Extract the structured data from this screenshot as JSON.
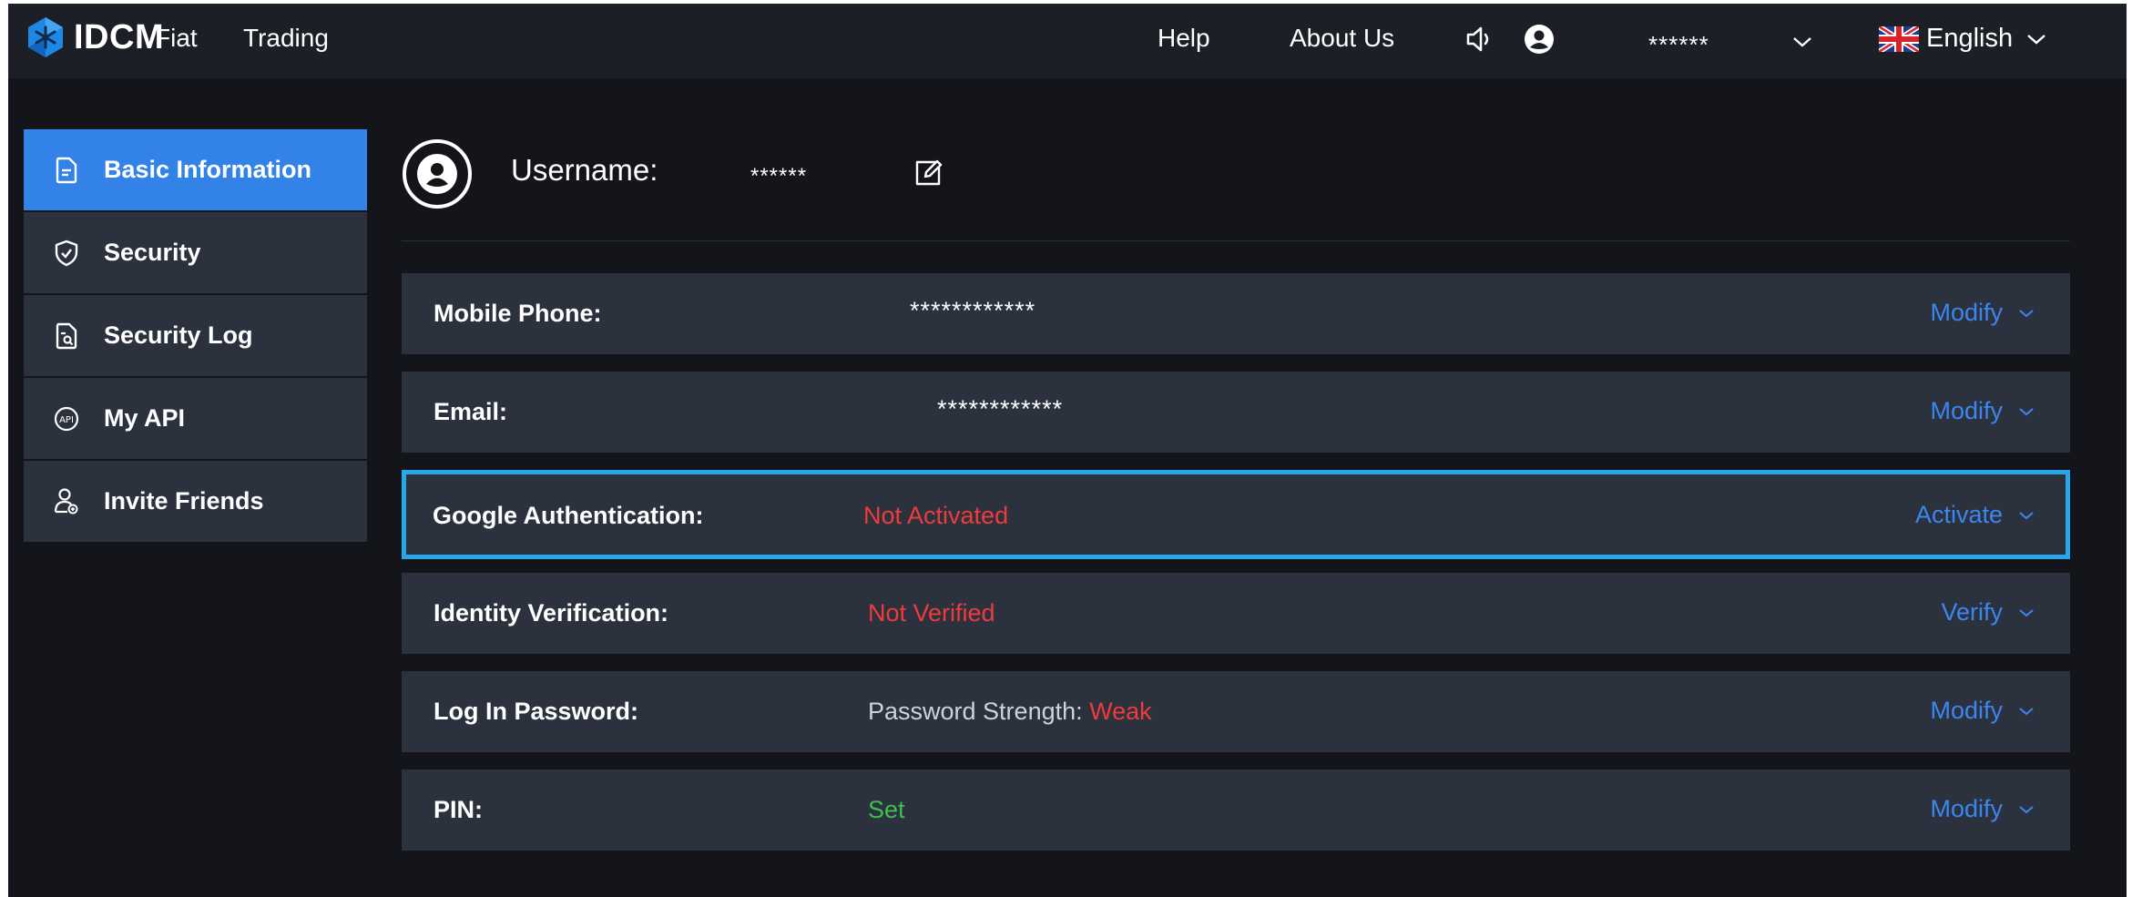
{
  "header": {
    "brand": "IDCM",
    "nav": [
      "Fiat",
      "Trading"
    ],
    "help": "Help",
    "about": "About Us",
    "username": "******",
    "language": "English"
  },
  "sidebar": {
    "items": [
      {
        "label": "Basic Information",
        "icon": "document-icon",
        "active": true
      },
      {
        "label": "Security",
        "icon": "shield-icon",
        "active": false
      },
      {
        "label": "Security Log",
        "icon": "log-file-icon",
        "active": false
      },
      {
        "label": "My API",
        "icon": "api-icon",
        "active": false
      },
      {
        "label": "Invite Friends",
        "icon": "invite-user-icon",
        "active": false
      }
    ]
  },
  "profile": {
    "username_label": "Username:",
    "username_value": "******"
  },
  "rows": [
    {
      "label": "Mobile Phone:",
      "value": "************",
      "status_color": "#ffffff",
      "action": "Modify",
      "highlighted": false
    },
    {
      "label": "Email:",
      "value": "************",
      "status_color": "#ffffff",
      "action": "Modify",
      "highlighted": false
    },
    {
      "label": "Google Authentication:",
      "value": "Not Activated",
      "status_color": "#ef3b3b",
      "action": "Activate",
      "highlighted": true
    },
    {
      "label": "Identity Verification:",
      "value": "Not Verified",
      "status_color": "#ef3b3b",
      "action": "Verify",
      "highlighted": false
    },
    {
      "label": "Log In Password:",
      "value_prefix": "Password Strength:",
      "value": "Weak",
      "status_color": "#ef3b3b",
      "action": "Modify",
      "highlighted": false
    },
    {
      "label": "PIN:",
      "value": "Set",
      "status_color": "#3fbf4f",
      "action": "Modify",
      "highlighted": false
    }
  ],
  "colors": {
    "accent": "#3282e8",
    "link": "#3b86f0",
    "highlight_border": "#28a8ea",
    "panel": "#2b323d",
    "background": "#14151b"
  }
}
